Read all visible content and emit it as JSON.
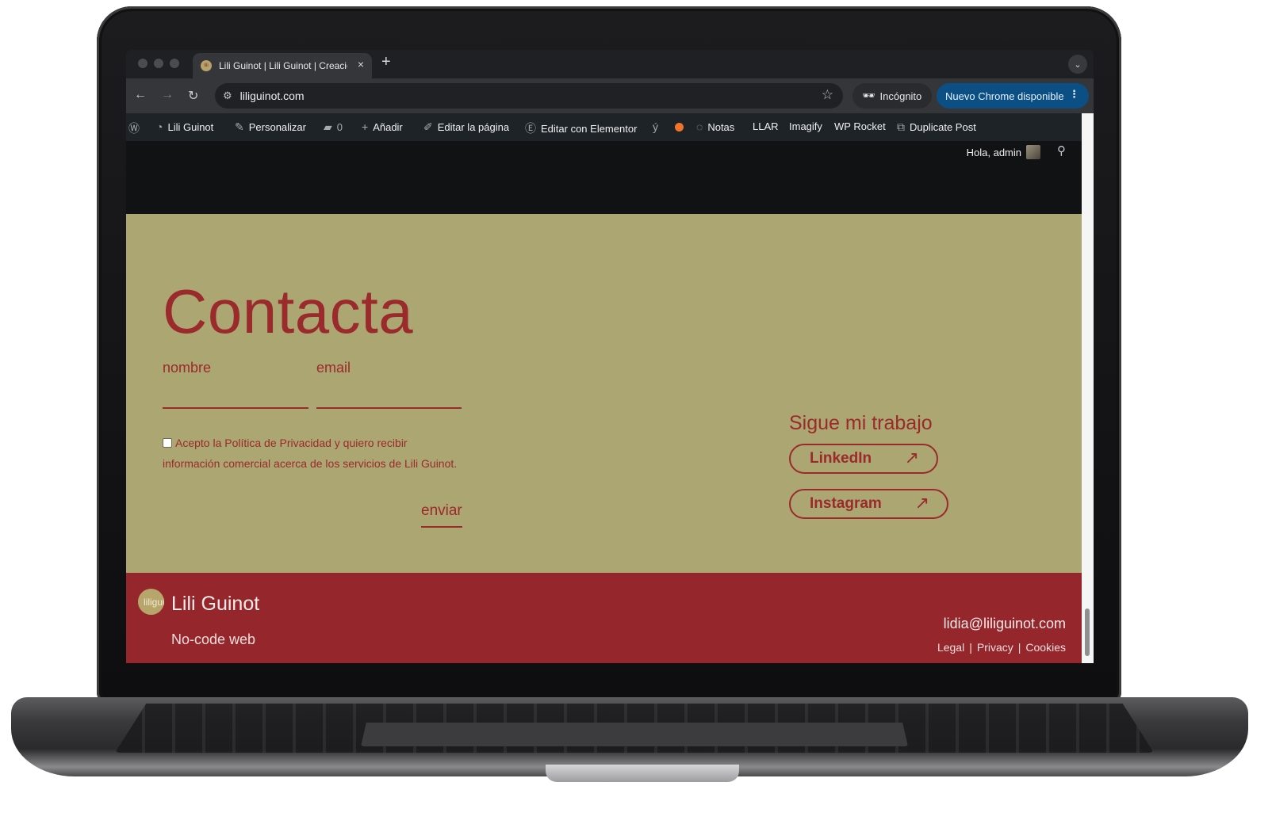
{
  "browser": {
    "tab_title": "Lili Guinot | Lili Guinot | Creación",
    "tab_close": "×",
    "new_tab": "+",
    "tab_dropdown": "⌄",
    "url": "liliguinot.com",
    "incognito_label": "Incógnito",
    "update_label": "Nuevo Chrome disponible",
    "update_menu": "⋮"
  },
  "adminbar": {
    "site_name": "Lili Guinot",
    "customize": "Personalizar",
    "comments_count": "0",
    "add_new": "Añadir",
    "edit_page": "Editar la página",
    "edit_elementor": "Editar con Elementor",
    "notes": "Notas",
    "llar": "LLAR",
    "imagify": "Imagify",
    "wp_rocket": "WP Rocket",
    "duplicate_post": "Duplicate Post",
    "greeting": "Hola, admin"
  },
  "contact": {
    "title": "Contacta",
    "name_label": "nombre",
    "email_label": "email",
    "consent_text": "Acepto la Política de Privacidad y quiero recibir información comercial acerca de los servicios de Lili Guinot.",
    "send_label": "enviar",
    "follow_title": "Sigue mi trabajo",
    "linkedin_label": "LinkedIn",
    "instagram_label": "Instagram",
    "arrow": "↗"
  },
  "footer": {
    "logo_text": "liliguinot",
    "brand_name": "Lili Guinot",
    "tagline": "No-code web",
    "email": "lidia@liliguinot.com",
    "legal": "Legal",
    "privacy": "Privacy",
    "cookies": "Cookies",
    "separator": "|"
  },
  "colors": {
    "contact_bg": "#aca672",
    "accent_red": "#9a2a2b",
    "footer_bg": "#95262b",
    "adminbar_bg": "#1d2327",
    "update_btn": "#0b4f84"
  },
  "icons": [
    "wordpress-logo-icon",
    "dashboard-icon",
    "brush-icon",
    "comment-icon",
    "plus-icon",
    "pencil-icon",
    "elementor-icon",
    "yoast-icon",
    "notes-icon",
    "duplicate-icon",
    "search-icon",
    "star-icon",
    "back-icon",
    "forward-icon",
    "reload-icon",
    "incognito-icon",
    "site-info-icon"
  ]
}
